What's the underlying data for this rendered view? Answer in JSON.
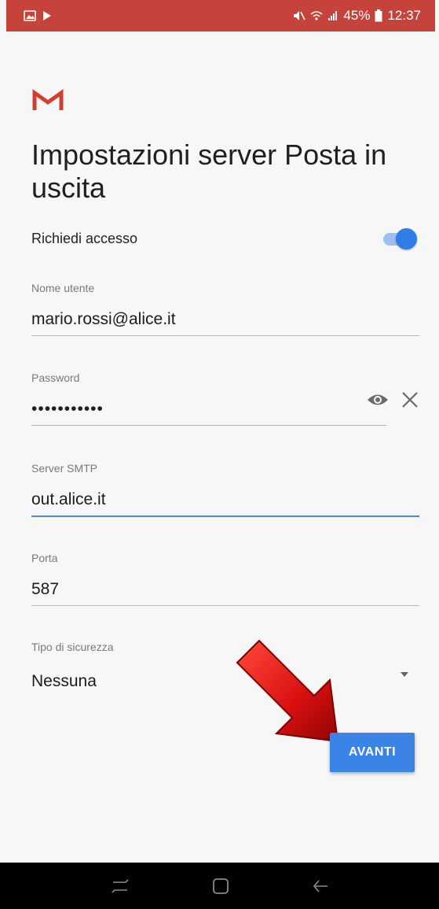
{
  "status_bar": {
    "battery_text": "45%",
    "time": "12:37",
    "color": "#c6433c"
  },
  "header": {
    "logo_icon": "gmail-logo-icon",
    "title": "Impostazioni server Posta in uscita"
  },
  "auth": {
    "label": "Richiedi accesso",
    "enabled": true
  },
  "username": {
    "label": "Nome utente",
    "value": "mario.rossi@alice.it"
  },
  "password": {
    "label": "Password",
    "value": "•••••••••••",
    "show_icon": "eye-icon",
    "clear_icon": "close-icon"
  },
  "smtp_server": {
    "label": "Server SMTP",
    "value": "out.alice.it"
  },
  "port": {
    "label": "Porta",
    "value": "587"
  },
  "security": {
    "label": "Tipo di sicurezza",
    "selected": "Nessuna"
  },
  "next_button": {
    "label": "AVANTI",
    "color": "#3b84e6"
  },
  "accent_color": "#4f86d8",
  "nav_bar": {
    "recents_icon": "recents-icon",
    "home_icon": "home-icon",
    "back_icon": "back-icon"
  }
}
